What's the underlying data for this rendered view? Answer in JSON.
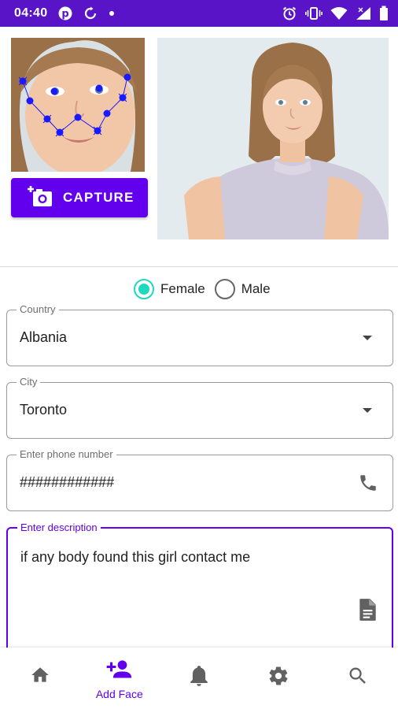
{
  "status_bar": {
    "time": "04:40",
    "icons": [
      "pinterest-icon",
      "sync-icon",
      "dot-icon",
      "alarm-icon",
      "vibrate-icon",
      "wifi-icon",
      "signal-icon",
      "battery-icon"
    ]
  },
  "capture_button": {
    "label": "CAPTURE",
    "icon": "add-photo-icon"
  },
  "gender": {
    "options": [
      {
        "label": "Female",
        "checked": true
      },
      {
        "label": "Male",
        "checked": false
      }
    ]
  },
  "form": {
    "country": {
      "label": "Country",
      "value": "Albania"
    },
    "city": {
      "label": "City",
      "value": "Toronto"
    },
    "phone": {
      "label": "Enter phone number",
      "value": "############"
    },
    "description": {
      "label": "Enter description",
      "value": "if any body found this girl contact me"
    }
  },
  "bottom_nav": {
    "items": [
      {
        "icon": "home-icon"
      },
      {
        "icon": "add-person-icon",
        "label": "Add Face",
        "active": true
      },
      {
        "icon": "bell-icon"
      },
      {
        "icon": "gear-icon"
      },
      {
        "icon": "search-icon"
      }
    ]
  },
  "colors": {
    "primary": "#6200ee",
    "status_bar": "#5a14c8",
    "radio_checked": "#1ed8c0",
    "landmark_dots": "#1a1aff"
  }
}
